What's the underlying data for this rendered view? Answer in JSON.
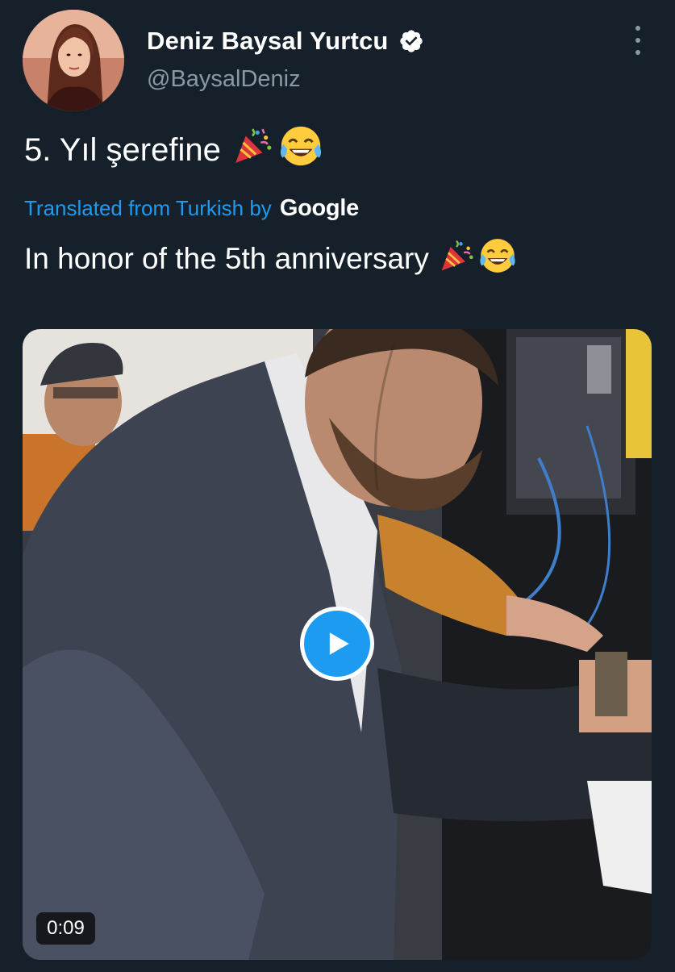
{
  "tweet": {
    "author": {
      "display_name": "Deniz Baysal Yurtcu",
      "handle": "@BaysalDeniz",
      "verified": true,
      "avatar_icon": "profile-photo"
    },
    "more_icon": "more-vertical-icon",
    "text": "5. Yıl şerefine",
    "text_emojis": [
      "🎉",
      "😂"
    ],
    "translation": {
      "label": "Translated from Turkish by",
      "provider": "Google",
      "text": "In honor of the 5th anniversary",
      "emojis": [
        "🎉",
        "😂"
      ]
    },
    "media": {
      "type": "video",
      "duration": "0:09",
      "play_icon": "play-icon"
    }
  },
  "colors": {
    "background": "#15202b",
    "text_primary": "#ffffff",
    "text_secondary": "#8899a6",
    "accent": "#1d9bf0"
  }
}
